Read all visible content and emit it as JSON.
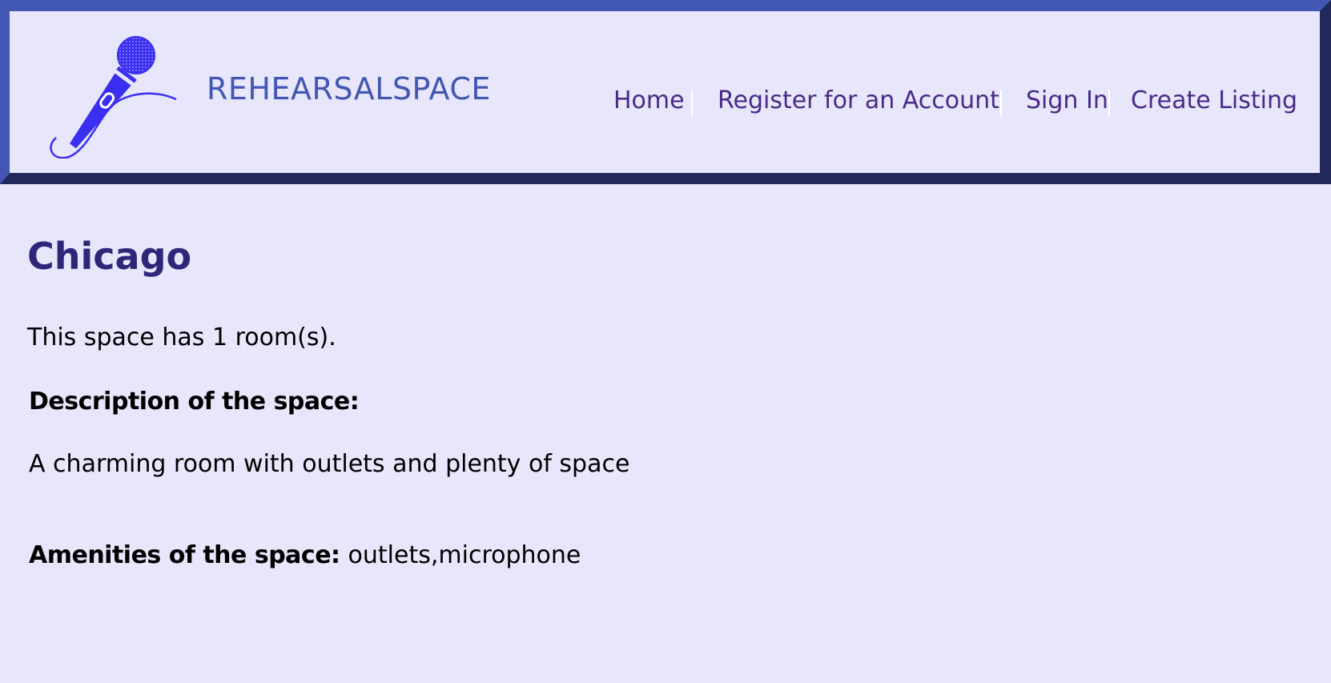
{
  "header": {
    "brand": "REHEARSALSPACE",
    "logo_icon": "microphone-icon",
    "nav": {
      "home": "Home",
      "register": "Register for an Account",
      "sign_in": "Sign In",
      "create_listing": "Create Listing"
    }
  },
  "listing": {
    "title": "Chicago",
    "rooms_text": "This space has 1 room(s).",
    "description_label": "Description of the space:",
    "description": "A charming room with outlets and plenty of space",
    "amenities_label": "Amenities of the space:",
    "amenities": "outlets,microphone"
  },
  "colors": {
    "background": "#e8e6fb",
    "border_light": "#4257b2",
    "border_dark": "#21295c",
    "brand": "#4257b2",
    "nav_link": "#4a2a86",
    "title": "#2e2779",
    "logo": "#3a2ff0"
  }
}
